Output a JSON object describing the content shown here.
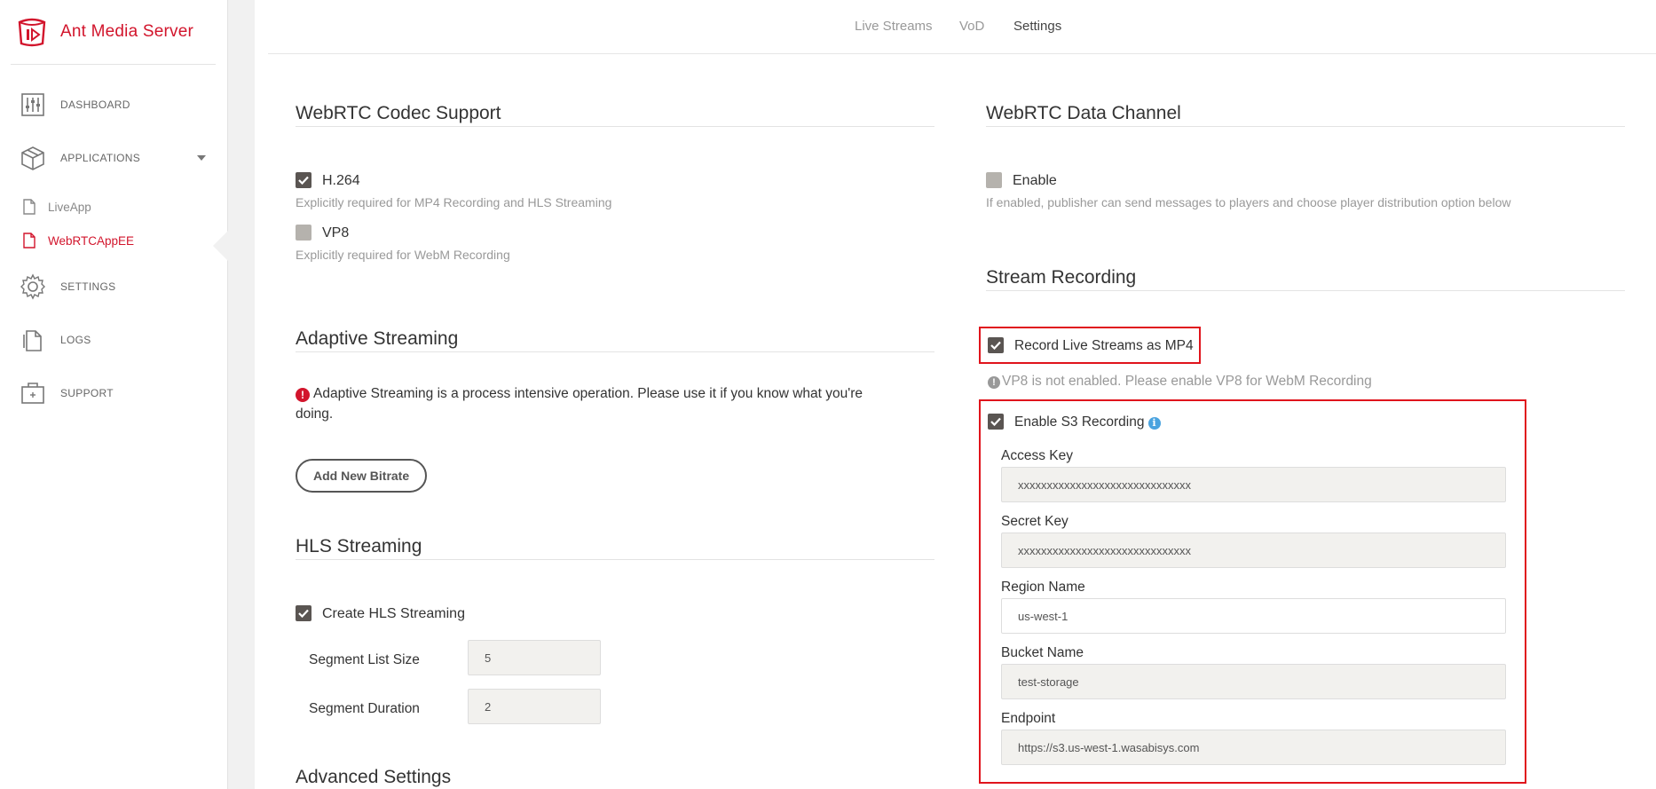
{
  "app": {
    "name": "Ant Media Server",
    "brand_color": "#d2152c"
  },
  "sidebar": {
    "dashboard": "DASHBOARD",
    "applications": "APPLICATIONS",
    "apps": [
      "LiveApp",
      "WebRTCAppEE"
    ],
    "settings": "SETTINGS",
    "logs": "LOGS",
    "support": "SUPPORT"
  },
  "topnav": {
    "tabs": [
      "Live Streams",
      "VoD",
      "Settings"
    ],
    "active": "Settings"
  },
  "codec": {
    "title": "WebRTC Codec Support",
    "h264_label": "H.264",
    "h264_help": "Explicitly required for MP4 Recording and HLS Streaming",
    "h264_checked": true,
    "vp8_label": "VP8",
    "vp8_help": "Explicitly required for WebM Recording",
    "vp8_checked": false
  },
  "adaptive": {
    "title": "Adaptive Streaming",
    "warning": "Adaptive Streaming is a process intensive operation. Please use it if you know what you're doing.",
    "add_button": "Add New Bitrate"
  },
  "hls": {
    "title": "HLS Streaming",
    "create_label": "Create HLS Streaming",
    "create_checked": true,
    "segment_list_size_label": "Segment List Size",
    "segment_list_size": "5",
    "segment_duration_label": "Segment Duration",
    "segment_duration": "2"
  },
  "advanced": {
    "title": "Advanced Settings"
  },
  "datachannel": {
    "title": "WebRTC Data Channel",
    "enable_label": "Enable",
    "enable_checked": false,
    "help": "If enabled, publisher can send messages to players and choose player distribution option below"
  },
  "recording": {
    "title": "Stream Recording",
    "mp4_label": "Record Live Streams as MP4",
    "mp4_checked": true,
    "vp8_note": "VP8 is not enabled. Please enable VP8 for WebM Recording",
    "s3_label": "Enable S3 Recording",
    "s3_checked": true,
    "access_key_label": "Access Key",
    "access_key": "xxxxxxxxxxxxxxxxxxxxxxxxxxxxxx",
    "secret_key_label": "Secret Key",
    "secret_key": "xxxxxxxxxxxxxxxxxxxxxxxxxxxxxx",
    "region_label": "Region Name",
    "region": "us-west-1",
    "bucket_label": "Bucket Name",
    "bucket": "test-storage",
    "endpoint_label": "Endpoint",
    "endpoint": "https://s3.us-west-1.wasabisys.com"
  }
}
